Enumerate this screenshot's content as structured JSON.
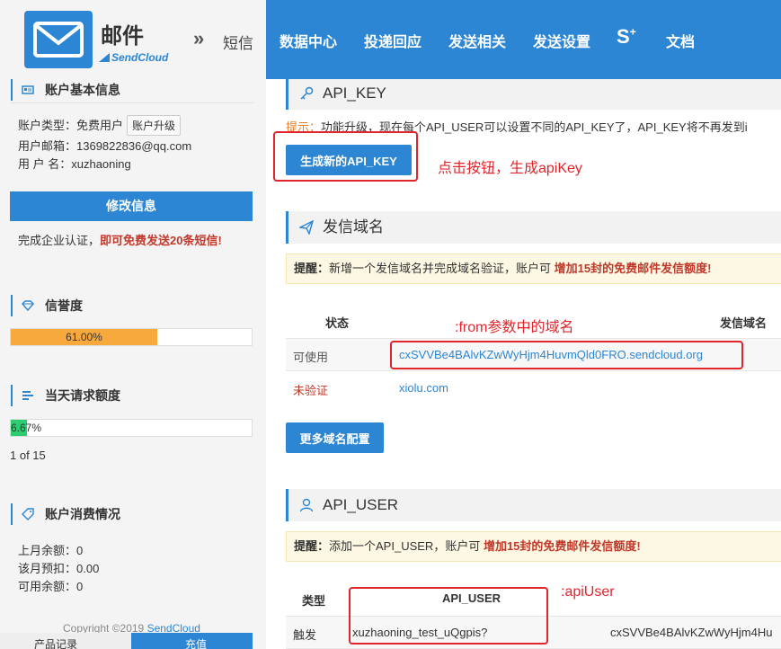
{
  "header": {
    "brand_title": "邮件",
    "brand_sub": "SendCloud",
    "breadcrumb_arrow": "»",
    "breadcrumb_sms": "短信",
    "nav": [
      "数据中心",
      "投递回应",
      "发送相关",
      "发送设置"
    ],
    "nav_s": "S",
    "nav_s_sup": "+",
    "nav_docs": "文档"
  },
  "sidebar": {
    "account_title": "账户基本信息",
    "account_type_label": "账户类型：",
    "account_type_value": "免费用户",
    "upgrade_button": "账户升级",
    "email_label": "用户邮箱：",
    "email_value": "1369822836@qq.com",
    "username_label": "用 户 名：",
    "username_value": "xuzhaoning",
    "modify_button": "修改信息",
    "promo_text": "完成企业认证，",
    "promo_highlight": "即可免费发送20条短信!",
    "credit_title": "信誉度",
    "credit_percent": "61.00%",
    "credit_fraction": 0.61,
    "quota_title": "当天请求额度",
    "quota_percent": "6.67%",
    "quota_fraction": 0.0667,
    "quota_count": "1 of 15",
    "spend_title": "账户消费情况",
    "last_month_label": "上月余额：",
    "last_month_value": "0",
    "prepaid_label": "该月预扣：",
    "prepaid_value": "0.00",
    "available_label": "可用余额：",
    "available_value": "0",
    "copyright_prefix": "Copyright ©2019 ",
    "copyright_link": "SendCloud",
    "bottom_left_tab": "产品记录",
    "bottom_right_tab": "充值"
  },
  "main": {
    "apikey_title": "API_KEY",
    "apikey_tip_label": "提示：",
    "apikey_tip_text": "功能升级，现在每个API_USER可以设置不同的API_KEY了，API_KEY将不再发到i",
    "apikey_button": "生成新的API_KEY",
    "apikey_note": "点击按钮，生成apiKey",
    "domain_title": "发信域名",
    "domain_notice_label": "提醒：",
    "domain_notice_text": "新增一个发信域名并完成域名验证，账户可 ",
    "domain_notice_highlight": "增加15封的免费邮件发信额度!",
    "domain_col_status": "状态",
    "domain_col_domain": "发信域名",
    "domain_note": ":from参数中的域名",
    "domain_rows": [
      {
        "status": "可使用",
        "domain": "cxSVVBe4BAlvKZwWyHjm4HuvmQld0FRO.sendcloud.org"
      },
      {
        "status": "未验证",
        "domain": "xiolu.com"
      }
    ],
    "domain_more_button": "更多域名配置",
    "apiuser_title": "API_USER",
    "apiuser_notice_label": "提醒：",
    "apiuser_notice_text": "添加一个API_USER，账户可 ",
    "apiuser_notice_highlight": "增加15封的免费邮件发信额度!",
    "apiuser_col_type": "类型",
    "apiuser_col_user": "API_USER",
    "apiuser_note": ":apiUser",
    "apiuser_rows": [
      {
        "type": "触发",
        "user": "xuzhaoning_test_uQgpis?",
        "key": "cxSVVBe4BAlvKZwWyHjm4Hu"
      }
    ]
  },
  "colors": {
    "primary": "#2c86d3",
    "credit_bar": "#f7a93b",
    "quota_bar": "#2ecc71",
    "annotation_red": "#e0262c"
  }
}
